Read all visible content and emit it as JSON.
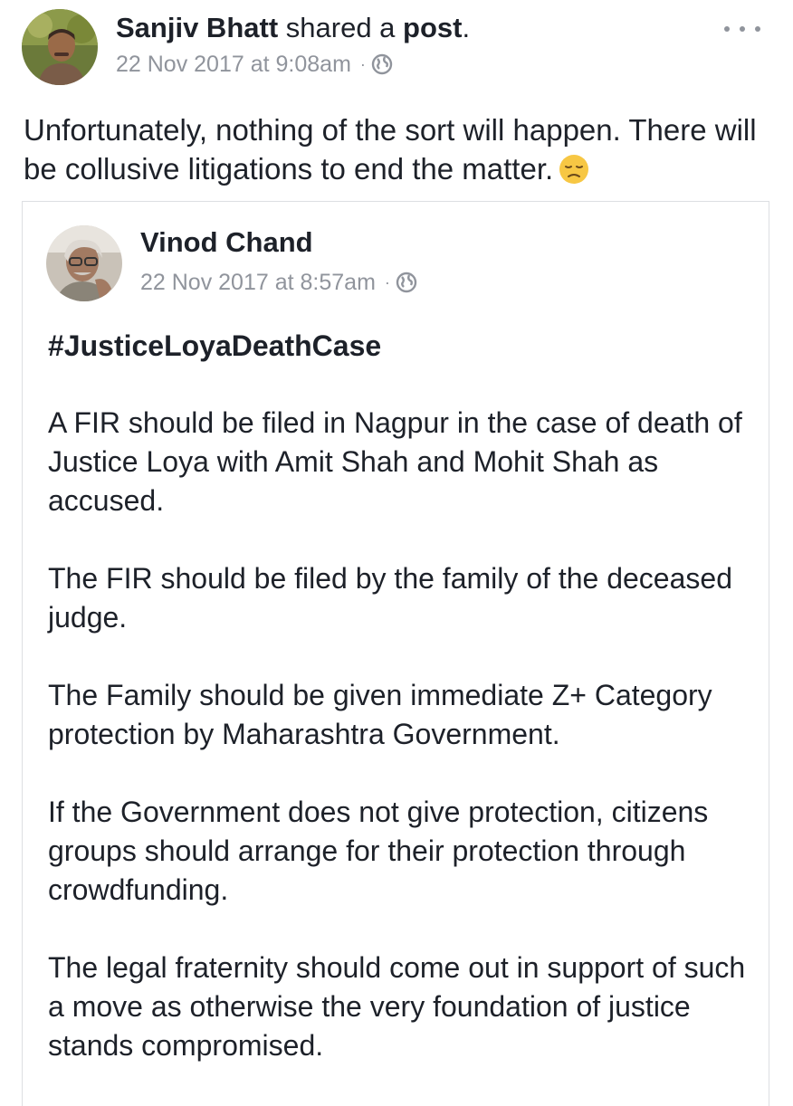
{
  "post": {
    "author": "Sanjiv Bhatt",
    "action_text": "shared a",
    "action_object": "post",
    "period": ".",
    "timestamp": "22 Nov 2017 at 9:08am",
    "separator": "·",
    "privacy_icon": "globe-icon",
    "menu_icon": "more-options-icon",
    "status_text": "Unfortunately, nothing of the sort will happen. There will be collusive litigations to end the matter.",
    "status_emoji": "disappointed-face-emoji"
  },
  "shared_post": {
    "author": "Vinod Chand",
    "timestamp": "22 Nov 2017 at 8:57am",
    "separator": "·",
    "privacy_icon": "globe-icon",
    "hashtag": "#JusticeLoyaDeathCase",
    "paragraphs": [
      "A FIR should be filed in Nagpur in the case of death of Justice Loya with Amit Shah and Mohit Shah as accused.",
      "The FIR should be filed by the family of the deceased judge.",
      "The Family should be given immediate Z+ Category protection by Maharashtra Government.",
      "If the Government does not give protection, citizens groups should arrange for their protection through crowdfunding.",
      "The legal fraternity should come out in support of such a move as otherwise the very foundation of justice stands compromised."
    ]
  },
  "colors": {
    "text_primary": "#1d2129",
    "text_meta": "#90949c",
    "card_border": "#dddfe2",
    "background": "#ffffff"
  }
}
